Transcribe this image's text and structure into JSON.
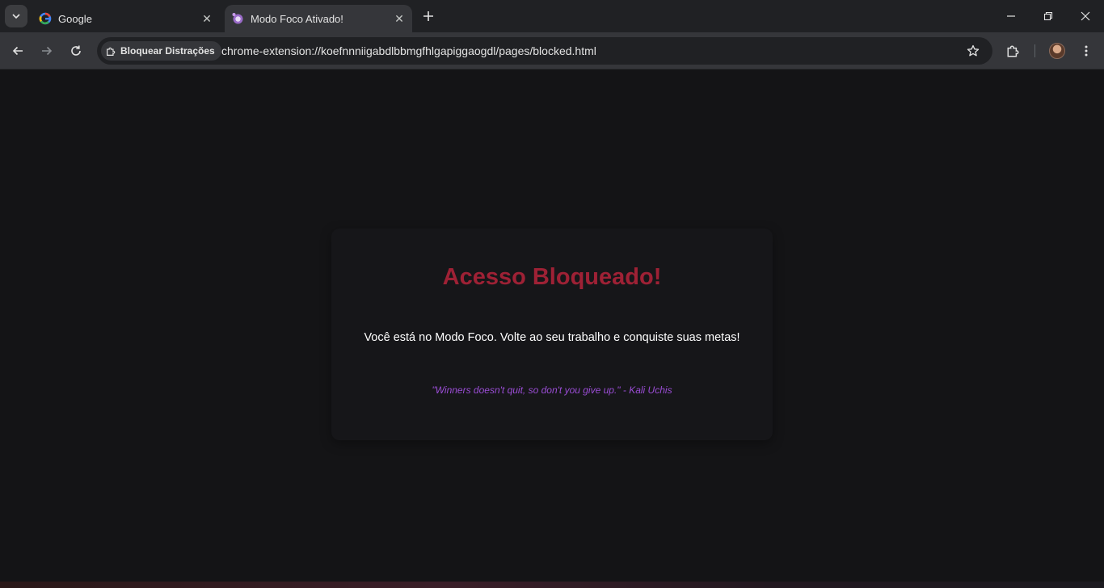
{
  "browser": {
    "tabs": [
      {
        "title": "Google",
        "active": false,
        "favicon": "google-g-icon"
      },
      {
        "title": "Modo Foco Ativado!",
        "active": true,
        "favicon": "extension-purple-icon"
      }
    ],
    "omnibox": {
      "chip_label": "Bloquear Distrações",
      "url": "chrome-extension://koefnnniigabdlbbmgfhlgapiggaogdl/pages/blocked.html"
    }
  },
  "page": {
    "heading": "Acesso Bloqueado!",
    "message": "Você está no Modo Foco. Volte ao seu trabalho e conquiste suas metas!",
    "quote": "\"Winners doesn't quit, so don't you give up.\" - Kali Uchis"
  },
  "colors": {
    "heading": "#9e2135",
    "quote": "#9b4dd6",
    "background": "#141416"
  }
}
